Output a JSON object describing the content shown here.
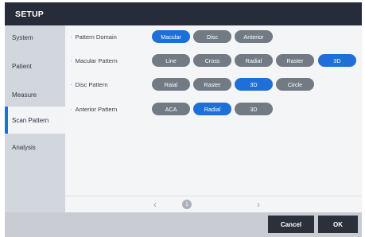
{
  "window": {
    "title": "SETUP"
  },
  "sidebar": {
    "items": [
      {
        "label": "System"
      },
      {
        "label": "Patient"
      },
      {
        "label": "Measure"
      },
      {
        "label": "Scan Pattern",
        "active": true
      },
      {
        "label": "Analysis"
      }
    ]
  },
  "settings": {
    "bullet": "·",
    "rows": [
      {
        "label": "Pattern Domain",
        "options": [
          {
            "label": "Macular",
            "selected": true
          },
          {
            "label": "Disc",
            "selected": false
          },
          {
            "label": "Anterior",
            "selected": false
          }
        ]
      },
      {
        "label": "Macular Pattern",
        "options": [
          {
            "label": "Line",
            "selected": false
          },
          {
            "label": "Cross",
            "selected": false
          },
          {
            "label": "Radial",
            "selected": false
          },
          {
            "label": "Raster",
            "selected": false
          },
          {
            "label": "3D",
            "selected": true
          }
        ]
      },
      {
        "label": "Disc Pattern",
        "options": [
          {
            "label": "Raial",
            "selected": false
          },
          {
            "label": "Raster",
            "selected": false
          },
          {
            "label": "3D",
            "selected": true
          },
          {
            "label": "Circle",
            "selected": false
          }
        ]
      },
      {
        "label": "Anterior Pattern",
        "options": [
          {
            "label": "ACA",
            "selected": false
          },
          {
            "label": "Radial",
            "selected": true
          },
          {
            "label": "3D",
            "selected": false
          }
        ]
      }
    ]
  },
  "pager": {
    "prev": "‹",
    "next": "›",
    "current": "1"
  },
  "footer": {
    "cancel_label": "Cancel",
    "ok_label": "OK"
  },
  "colors": {
    "accent": "#1f6fd8",
    "pill": "#727a84",
    "titlebar": "#262c3a",
    "sidebar": "#d2d6dd",
    "footer": "#c9ccd3"
  }
}
